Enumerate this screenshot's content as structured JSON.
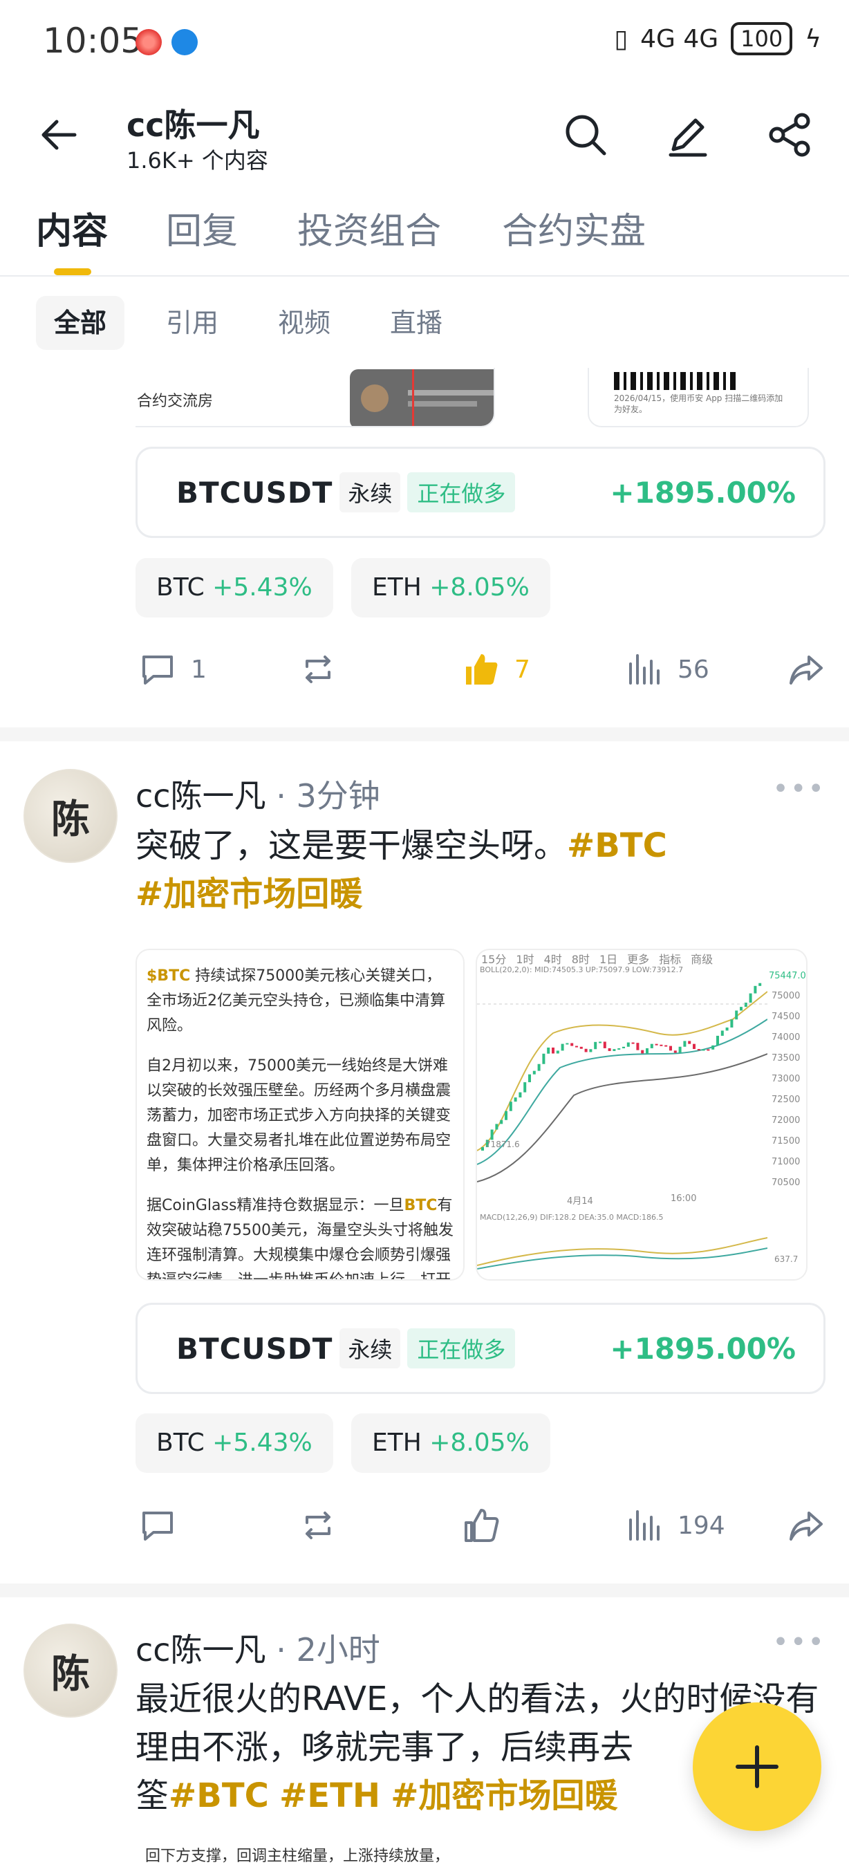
{
  "status_bar": {
    "time": "10:05",
    "network": "4G 4G",
    "battery": "100"
  },
  "header": {
    "title": "cc陈一凡",
    "subtitle": "1.6K+ 个内容"
  },
  "tabs": [
    "内容",
    "回复",
    "投资组合",
    "合约实盘"
  ],
  "filters": [
    "全部",
    "引用",
    "视频",
    "直播"
  ],
  "strip": {
    "text_left": "合约交流房",
    "qr_text": "2026/04/15，使用币安 App 扫描二维码添加为好友。"
  },
  "posts": [
    {
      "position": {
        "symbol": "BTCUSDT",
        "type": "永续",
        "status": "正在做多",
        "pnl": "+1895.00%"
      },
      "coins": [
        {
          "name": "BTC",
          "change": "+5.43%"
        },
        {
          "name": "ETH",
          "change": "+8.05%"
        }
      ],
      "actions": {
        "comments": "1",
        "likes": "7",
        "views": "56"
      }
    },
    {
      "author": "cc陈一凡",
      "time": "· 3分钟",
      "text": "突破了，这是要干爆空头呀。",
      "hashtags": [
        "#BTC",
        "#加密市场回暖"
      ],
      "article": {
        "p1_tag": "$BTC",
        "p1": " 持续试探75000美元核心关键关口，全市场近2亿美元空头持仓，已濒临集中清算风险。",
        "p2": "自2月初以来，75000美元一线始终是大饼难以突破的长效强压壁垒。历经两个多月横盘震荡蓄力，加密市场正式步入方向抉择的关键变盘窗口。大量交易者扎堆在此位置逆势布局空单，集体押注价格承压回落。",
        "p3a": "据CoinGlass精准持仓数据显示：一旦",
        "p3_tag": "BTC",
        "p3b": "有效突破站稳75500美元，海量空头头寸将触发连环强制清算。大规模集中爆仓会顺势引爆强势逼空行情，进一步助推币价加速上行，打开全新上涨空间。"
      },
      "chart": {
        "tabs": [
          "15分",
          "1时",
          "4时",
          "8时",
          "1日",
          "更多",
          "指标",
          "商级"
        ],
        "boll": "BOLL(20,2,0): MID:74505.3 UP:75097.9 LOW:73912.7",
        "last_price": "75447.0",
        "price_ticks": [
          "75000",
          "74500",
          "74000",
          "73500",
          "73000",
          "72500",
          "72000",
          "71500",
          "71000",
          "70500"
        ],
        "low_label": "71871.6",
        "time_labels": [
          "4月14",
          "16:00"
        ],
        "macd": "MACD(12,26,9) DIF:128.2 DEA:35.0 MACD:186.5",
        "macd_val": "637.7"
      },
      "position": {
        "symbol": "BTCUSDT",
        "type": "永续",
        "status": "正在做多",
        "pnl": "+1895.00%"
      },
      "coins": [
        {
          "name": "BTC",
          "change": "+5.43%"
        },
        {
          "name": "ETH",
          "change": "+8.05%"
        }
      ],
      "actions": {
        "views": "194"
      }
    },
    {
      "author": "cc陈一凡",
      "time": "· 2小时",
      "text": "最近很火的RAVE，个人的看法，火的时候没有理由不涨，哆就完事了，后续再去",
      "text2": "筌",
      "hashtags": [
        "#BTC",
        "#ETH",
        "#加密市场回暖"
      ],
      "snippet": "回下方支撑，回调主柱缩量，上涨持续放量，"
    }
  ],
  "avatar_char": "陈",
  "colors": {
    "accent": "#f0b90b",
    "up": "#2ebd85",
    "hashtag": "#c99400",
    "fab": "#fcd535"
  }
}
